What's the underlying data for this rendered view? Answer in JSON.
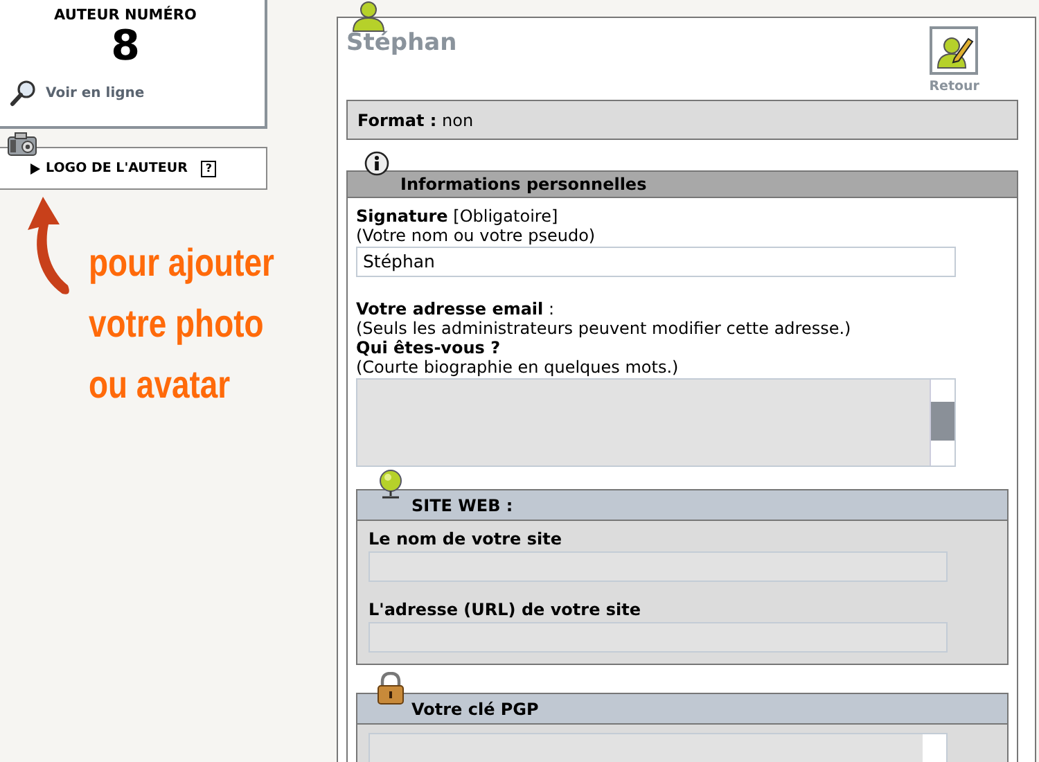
{
  "sidebar": {
    "author_box": {
      "heading": "AUTEUR NUMÉRO",
      "number": "8",
      "link": "Voir en ligne"
    },
    "logo_box": {
      "label": "LOGO DE L'AUTEUR",
      "help": "?"
    }
  },
  "annotation": {
    "lines": [
      "pour ajouter",
      "votre photo",
      "ou avatar"
    ]
  },
  "main": {
    "title": "Stéphan",
    "back_button": "Retour",
    "format": {
      "label": "Format :",
      "value": "non"
    },
    "personal": {
      "heading": "Informations personnelles",
      "fields": [
        {
          "kind": "input",
          "label": "**Signature** [Obligatoire]",
          "hint": "(Votre nom ou votre pseudo)",
          "value": "Stéphan"
        },
        {
          "kind": "text",
          "label": "**Votre adresse email** :",
          "hint": "(Seuls les administrateurs peuvent modifier cette adresse.)"
        },
        {
          "kind": "textarea",
          "label": "**Qui êtes-vous ?**",
          "hint": "(Courte biographie en quelques mots.)"
        }
      ]
    },
    "site_web": {
      "heading": "SITE WEB :",
      "fields": [
        {
          "label": "Le nom de votre site"
        },
        {
          "label": "L'adresse (URL) de votre site"
        }
      ]
    },
    "pgp": {
      "heading": "Votre clé PGP"
    }
  }
}
